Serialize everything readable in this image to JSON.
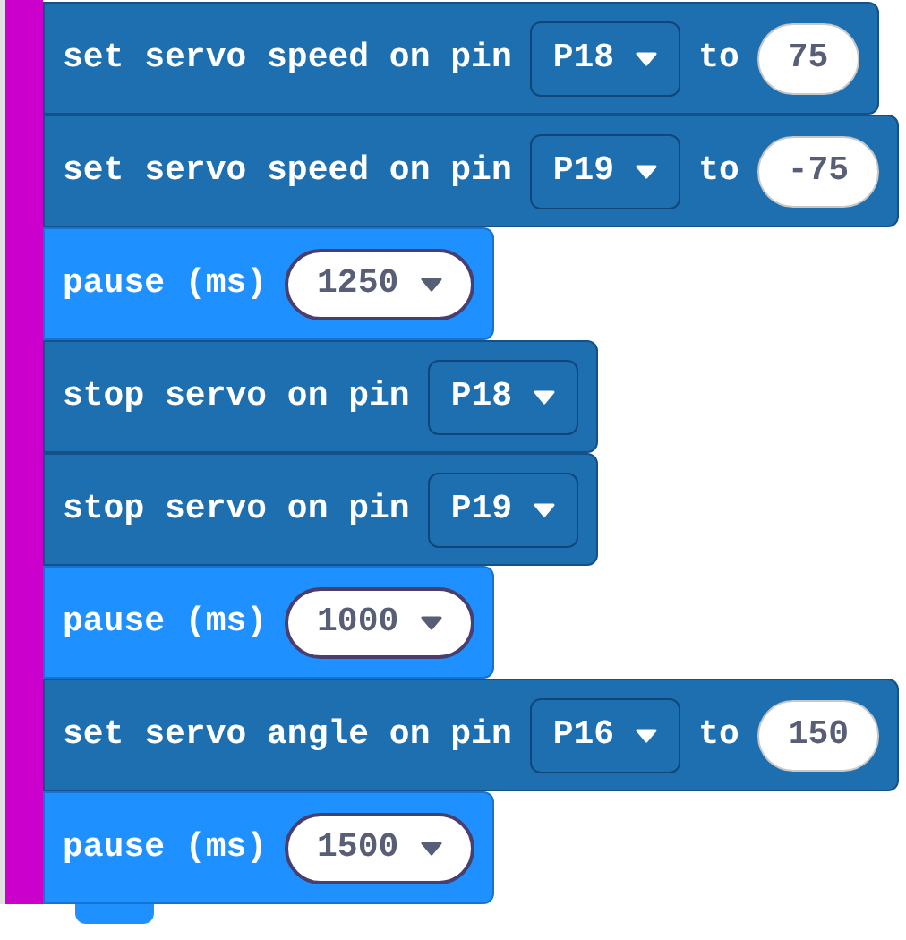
{
  "blocks": [
    {
      "kind": "servo",
      "parts": [
        {
          "kind": "label",
          "text": "set servo speed on pin"
        },
        {
          "kind": "dropdown",
          "text": "P18"
        },
        {
          "kind": "label",
          "text": "to"
        },
        {
          "kind": "number",
          "text": "75"
        }
      ]
    },
    {
      "kind": "servo",
      "parts": [
        {
          "kind": "label",
          "text": "set servo speed on pin"
        },
        {
          "kind": "dropdown",
          "text": "P19"
        },
        {
          "kind": "label",
          "text": "to"
        },
        {
          "kind": "number",
          "text": "-75"
        }
      ]
    },
    {
      "kind": "pause",
      "parts": [
        {
          "kind": "label",
          "text": "pause (ms)"
        },
        {
          "kind": "dropdown",
          "text": "1250"
        }
      ]
    },
    {
      "kind": "servo",
      "parts": [
        {
          "kind": "label",
          "text": "stop servo on pin"
        },
        {
          "kind": "dropdown",
          "text": "P18"
        }
      ]
    },
    {
      "kind": "servo",
      "parts": [
        {
          "kind": "label",
          "text": "stop servo on pin"
        },
        {
          "kind": "dropdown",
          "text": "P19"
        }
      ]
    },
    {
      "kind": "pause",
      "parts": [
        {
          "kind": "label",
          "text": "pause (ms)"
        },
        {
          "kind": "dropdown",
          "text": "1000"
        }
      ]
    },
    {
      "kind": "servo",
      "parts": [
        {
          "kind": "label",
          "text": "set servo angle on pin"
        },
        {
          "kind": "dropdown",
          "text": "P16"
        },
        {
          "kind": "label",
          "text": "to"
        },
        {
          "kind": "number",
          "text": "150"
        }
      ]
    },
    {
      "kind": "pause",
      "parts": [
        {
          "kind": "label",
          "text": "pause (ms)"
        },
        {
          "kind": "dropdown",
          "text": "1500"
        }
      ]
    }
  ]
}
